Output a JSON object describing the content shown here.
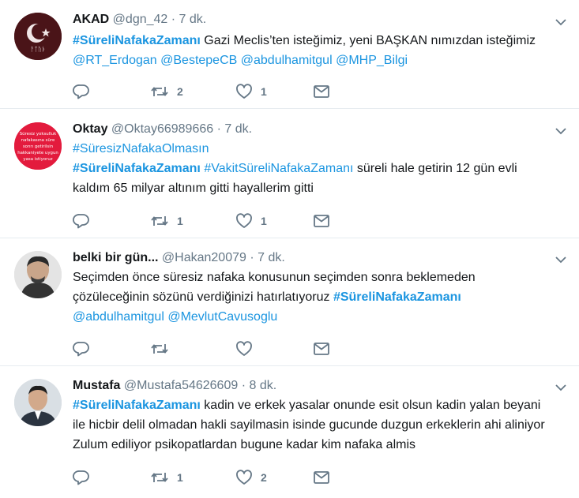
{
  "tweets": [
    {
      "name": "AKAD",
      "handle": "@dgn_42",
      "time": "7 dk.",
      "body": [
        {
          "t": "tag",
          "v": "#SüreliNafakaZamanı"
        },
        {
          "t": "text",
          "v": "  Gazi  Meclis’ten isteğimiz, yeni BAŞKAN nımızdan isteğimiz "
        },
        {
          "t": "mention",
          "v": "@RT_Erdogan"
        },
        {
          "t": "text",
          "v": " "
        },
        {
          "t": "mention",
          "v": "@BestepeCB"
        },
        {
          "t": "text",
          "v": " "
        },
        {
          "t": "mention",
          "v": "@abdulhamitgul"
        },
        {
          "t": "text",
          "v": " "
        },
        {
          "t": "mention",
          "v": "@MHP_Bilgi"
        }
      ],
      "reply_count": "",
      "retweet_count": "2",
      "like_count": "1"
    },
    {
      "name": "Oktay",
      "handle": "@Oktay66989666",
      "time": "7 dk.",
      "avatar_text": [
        "Süresiz yoksulluk",
        "nafakasına süre",
        "sonrı getirilsin",
        "hakkaniyete uygun",
        "yasa istiyoruz"
      ],
      "body": [
        {
          "t": "tagplain",
          "v": "#SüresizNafakaOlmasın"
        },
        {
          "t": "br"
        },
        {
          "t": "tag",
          "v": "#SüreliNafakaZamanı"
        },
        {
          "t": "text",
          "v": " "
        },
        {
          "t": "tagplain",
          "v": "#VakitSüreliNafakaZamanı"
        },
        {
          "t": "text",
          "v": " süreli hale getirin 12 gün evli kaldım 65 milyar altınım gitti hayallerim gitti"
        }
      ],
      "reply_count": "",
      "retweet_count": "1",
      "like_count": "1"
    },
    {
      "name": "belki bir gün...",
      "handle": "@Hakan20079",
      "time": "7 dk.",
      "body": [
        {
          "t": "text",
          "v": "Seçimden önce süresiz nafaka konusunun seçimden sonra beklemeden çözüleceğinin sözünü verdiğinizi hatırlatıyoruz  "
        },
        {
          "t": "tag",
          "v": "#SüreliNafakaZamanı"
        },
        {
          "t": "text",
          "v": " "
        },
        {
          "t": "mention",
          "v": "@abdulhamitgul"
        },
        {
          "t": "text",
          "v": " "
        },
        {
          "t": "mention",
          "v": "@MevlutCavusoglu"
        }
      ],
      "reply_count": "",
      "retweet_count": "",
      "like_count": ""
    },
    {
      "name": "Mustafa",
      "handle": "@Mustafa54626609",
      "time": "8 dk.",
      "body": [
        {
          "t": "tag",
          "v": "#SüreliNafakaZamanı"
        },
        {
          "t": "text",
          "v": " kadin ve erkek yasalar onunde esit olsun kadin yalan beyani ile hicbir delil olmadan hakli sayilmasin isinde gucunde duzgun erkeklerin ahi aliniyor Zulum ediliyor psikopatlardan bugune kadar kim nafaka almis"
        }
      ],
      "reply_count": "",
      "retweet_count": "1",
      "like_count": "2"
    }
  ],
  "colors": {
    "link": "#1b95e0",
    "meta": "#657786",
    "icon": "#657786",
    "divider": "#e6ecf0",
    "akad_avatar": "#5a1a1f",
    "oktay_avatar": "#e31b3d"
  },
  "icons": {
    "reply": "reply-icon",
    "retweet": "retweet-icon",
    "like": "heart-icon",
    "dm": "envelope-icon",
    "more": "chevron-down-icon"
  }
}
